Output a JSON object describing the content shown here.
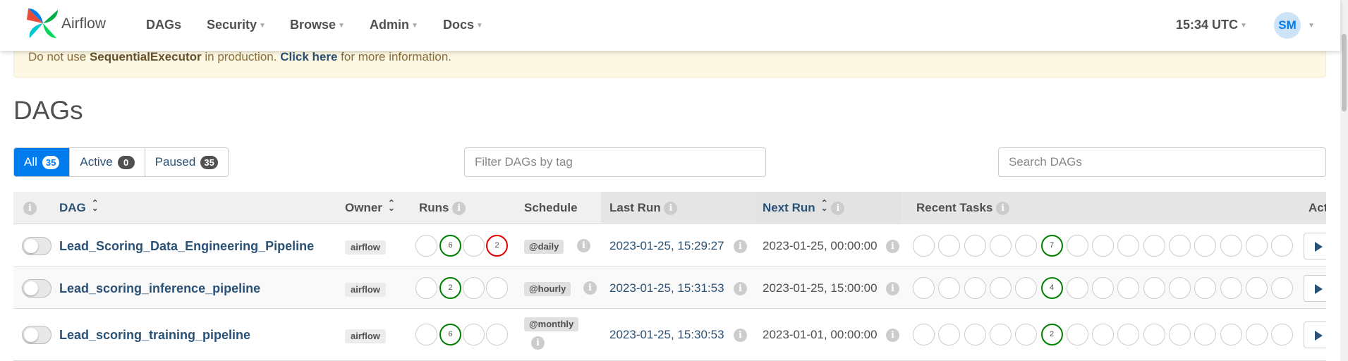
{
  "navbar": {
    "brand": "Airflow",
    "items": [
      {
        "label": "DAGs",
        "dropdown": false
      },
      {
        "label": "Security",
        "dropdown": true
      },
      {
        "label": "Browse",
        "dropdown": true
      },
      {
        "label": "Admin",
        "dropdown": true
      },
      {
        "label": "Docs",
        "dropdown": true
      }
    ],
    "clock": "15:34 UTC",
    "avatar": "SM"
  },
  "alert": {
    "before": "Do not use ",
    "executor": "SequentialExecutor",
    "middle": " in production. ",
    "link": "Click here",
    "after": " for more information."
  },
  "page": {
    "title": "DAGs"
  },
  "tabs": [
    {
      "label": "All",
      "count": "35",
      "active": true
    },
    {
      "label": "Active",
      "count": "0",
      "active": false
    },
    {
      "label": "Paused",
      "count": "35",
      "active": false
    }
  ],
  "filters": {
    "tag_placeholder": "Filter DAGs by tag",
    "search_placeholder": "Search DAGs"
  },
  "table": {
    "headers": {
      "info": "i",
      "dag": "DAG",
      "owner": "Owner",
      "runs": "Runs",
      "schedule": "Schedule",
      "last_run": "Last Run",
      "next_run": "Next Run",
      "recent_tasks": "Recent Tasks",
      "actions": "Actions"
    },
    "rows": [
      {
        "dag_id": "Lead_Scoring_Data_Engineering_Pipeline",
        "owner": "airflow",
        "runs": [
          "",
          "6",
          "",
          "2"
        ],
        "schedule": "@daily",
        "last_run": "2023-01-25, 15:29:27",
        "next_run": "2023-01-25, 00:00:00",
        "recent_task_highlight": "7"
      },
      {
        "dag_id": "Lead_scoring_inference_pipeline",
        "owner": "airflow",
        "runs": [
          "",
          "2",
          "",
          ""
        ],
        "schedule": "@hourly",
        "last_run": "2023-01-25, 15:31:53",
        "next_run": "2023-01-25, 15:00:00",
        "recent_task_highlight": "4"
      },
      {
        "dag_id": "Lead_scoring_training_pipeline",
        "owner": "airflow",
        "runs": [
          "",
          "6",
          "",
          ""
        ],
        "schedule": "@monthly",
        "last_run": "2023-01-25, 15:30:53",
        "next_run": "2023-01-01, 00:00:00",
        "recent_task_highlight": "2"
      }
    ]
  },
  "colors": {
    "primary": "#017cee",
    "success": "#008000",
    "failed": "#e00000",
    "link": "#2a5276"
  }
}
